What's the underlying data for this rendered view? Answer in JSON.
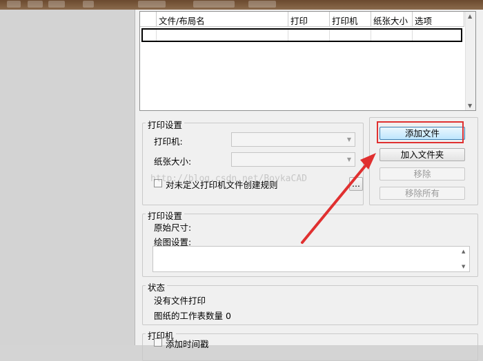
{
  "file_list": {
    "columns": [
      "",
      "文件/布局名",
      "打印",
      "打印机",
      "纸张大小",
      "选项"
    ]
  },
  "print_settings_group": {
    "title": "打印设置",
    "printer_label": "打印机:",
    "paper_label": "纸张大小:",
    "checkbox_label": "对未定义打印机文件创建规则",
    "more_button": "..."
  },
  "buttons": {
    "add_file": "添加文件",
    "add_folder": "加入文件夹",
    "remove": "移除",
    "remove_all": "移除所有"
  },
  "print_settings_info": {
    "title": "打印设置",
    "original_size": "原始尺寸:",
    "drawing_settings": "绘图设置:"
  },
  "status": {
    "title": "状态",
    "line1": "没有文件打印",
    "line2": "图纸的工作表数量 0"
  },
  "printer_group": {
    "title": "打印机",
    "timestamp_checkbox": "添加时间戳"
  },
  "watermark": "http://blog.csdn.net/BoykaCAD",
  "colors": {
    "annotation": "#e03030",
    "dialog_bg": "#f0f0f0",
    "left_pane": "#d3d3d3"
  }
}
